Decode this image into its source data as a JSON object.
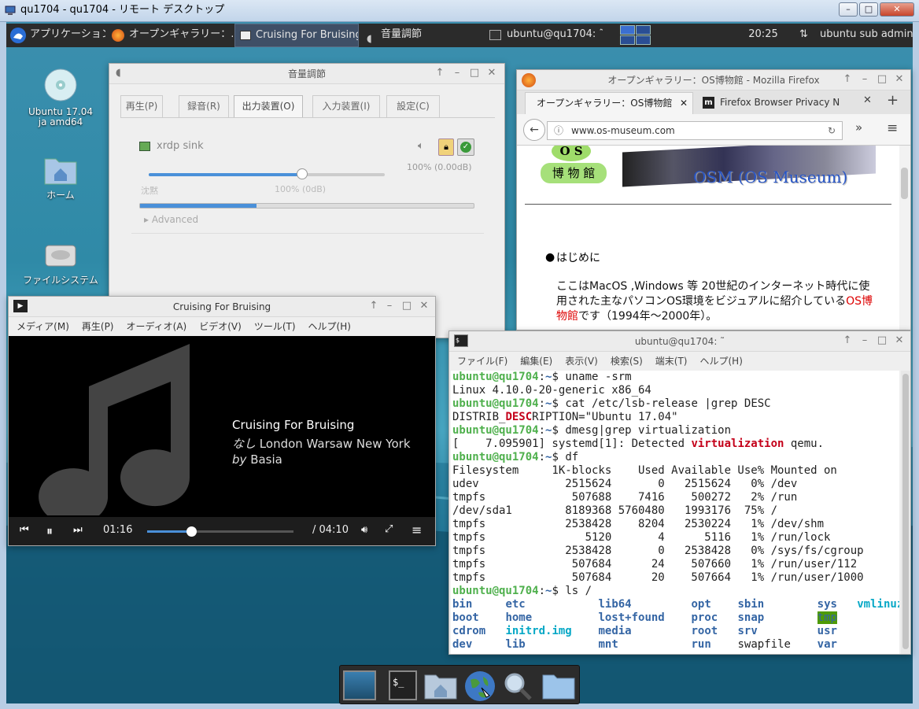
{
  "rdp": {
    "title": "qu1704 - qu1704 - リモート デスクトップ",
    "min": "–",
    "max": "□",
    "close": "✕"
  },
  "panel": {
    "apps_label": "アプリケーション",
    "tasks": [
      {
        "label": "オープンギャラリー：…",
        "icon": "firefox-icon"
      },
      {
        "label": "Cruising For Bruising",
        "icon": "media-player-icon",
        "active": true
      },
      {
        "label": "音量調節",
        "icon": "speaker-icon"
      },
      {
        "label": "ubuntu@qu1704: ˜",
        "icon": "terminal-icon"
      }
    ],
    "clock": "20:25",
    "user": "ubuntu sub admin"
  },
  "desktop_icons": [
    {
      "label1": "Ubuntu 17.04",
      "label2": "ja amd64",
      "icon": "cd-disc-icon"
    },
    {
      "label1": "ホーム",
      "label2": "",
      "icon": "home-folder-icon"
    },
    {
      "label1": "ファイルシステム",
      "label2": "",
      "icon": "hard-drive-icon"
    }
  ],
  "volume": {
    "title": "音量調節",
    "tabs": [
      "再生(P)",
      "録音(R)",
      "出力装置(O)",
      "入力装置(I)",
      "設定(C)"
    ],
    "active_tab": 2,
    "device": "xrdp sink",
    "percent_label": "100% (0.00dB)",
    "min_label": "沈黙",
    "mid_label": "100% (0dB)",
    "advanced": "Advanced",
    "volume_level": 0.65,
    "meter_level": 0.35
  },
  "player": {
    "title": "Cruising For Bruising",
    "menu": [
      "メディア(M)",
      "再生(P)",
      "オーディオ(A)",
      "ビデオ(V)",
      "ツール(T)",
      "ヘルプ(H)"
    ],
    "track": "Cruising For Bruising",
    "album_prefix": "なし",
    "album": "London Warsaw New York",
    "by_prefix": "by",
    "artist": "Basia",
    "elapsed": "01:16",
    "total": "/ 04:10",
    "progress": 0.3
  },
  "firefox": {
    "title": "オープンギャラリー：OS博物館 - Mozilla Firefox",
    "tab1": "オープンギャラリー：OS博物館",
    "tab2": "Firefox Browser Privacy N",
    "url": "www.os-museum.com",
    "logo_os": "O S",
    "logo_kanji": "博 物 館",
    "site_title": "OSM (OS Museum)",
    "bullet": "はじめに",
    "para1": "ここはMacOS ,Windows 等 20世紀のインターネット時代に使",
    "para2a": "用された主なパソコンOS環境をビジュアルに紹介している",
    "para2b": "OS博",
    "para3a": "物館",
    "para3b": "です（1994年〜2000年）。"
  },
  "terminal": {
    "title": "ubuntu@qu1704: ˜",
    "menu": [
      "ファイル(F)",
      "編集(E)",
      "表示(V)",
      "検索(S)",
      "端末(T)",
      "ヘルプ(H)"
    ],
    "prompt": "ubuntu@qu1704",
    "promptsep": ":~$ ",
    "cmd1": "uname -srm",
    "out1": "Linux 4.10.0-20-generic x86_64",
    "cmd2": "cat /etc/lsb-release |grep DESC",
    "out2a": "DISTRIB_",
    "out2b": "DESC",
    "out2c": "RIPTION=\"Ubuntu 17.04\"",
    "cmd3": "dmesg|grep virtualization",
    "out3a": "[    7.095901] systemd[1]: Detected ",
    "out3b": "virtualization",
    "out3c": " qemu.",
    "cmd4": "df",
    "df": [
      "Filesystem     1K-blocks    Used Available Use% Mounted on",
      "udev             2515624       0   2515624   0% /dev",
      "tmpfs             507688    7416    500272   2% /run",
      "/dev/sda1        8189368 5760480   1993176  75% /",
      "tmpfs            2538428    8204   2530224   1% /dev/shm",
      "tmpfs               5120       4      5116   1% /run/lock",
      "tmpfs            2538428       0   2538428   0% /sys/fs/cgroup",
      "tmpfs             507684      24    507660   1% /run/user/112",
      "tmpfs             507684      20    507664   1% /run/user/1000"
    ],
    "cmd5": "ls /",
    "ls": [
      [
        "bin",
        "etc",
        "lib64",
        "opt",
        "sbin",
        "sys",
        "vmlinuz"
      ],
      [
        "boot",
        "home",
        "lost+found",
        "proc",
        "snap",
        "tmp",
        ""
      ],
      [
        "cdrom",
        "initrd.img",
        "media",
        "root",
        "srv",
        "usr",
        ""
      ],
      [
        "dev",
        "lib",
        "mnt",
        "run",
        "swapfile",
        "var",
        ""
      ]
    ]
  },
  "dock": [
    "desktop-icon",
    "terminal-icon",
    "home-folder-icon",
    "web-browser-icon",
    "search-icon",
    "folder-icon"
  ]
}
